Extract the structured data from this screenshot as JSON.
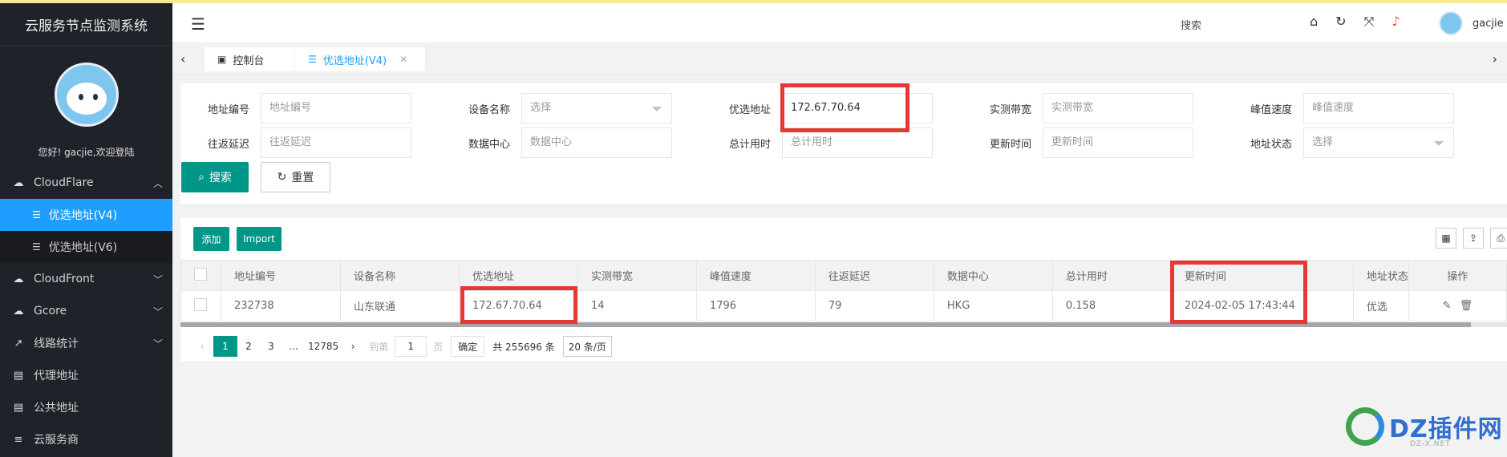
{
  "app": {
    "title": "云服务节点监测系统",
    "welcome": "您好! gacjie,欢迎登陆"
  },
  "sidebar": {
    "items": [
      {
        "label": "CloudFlare",
        "icon": "cloud-icon",
        "expanded": true
      },
      {
        "label": "优选地址(V4)",
        "icon": "list-icon",
        "active": true
      },
      {
        "label": "优选地址(V6)",
        "icon": "list-icon"
      },
      {
        "label": "CloudFront",
        "icon": "cloud-icon"
      },
      {
        "label": "Gcore",
        "icon": "cloud-icon"
      },
      {
        "label": "线路统计",
        "icon": "chart-icon"
      },
      {
        "label": "代理地址",
        "icon": "book-icon"
      },
      {
        "label": "公共地址",
        "icon": "book-icon"
      },
      {
        "label": "云服务商",
        "icon": "server-icon"
      }
    ]
  },
  "header": {
    "search_label": "搜索",
    "user_name": "gacjie"
  },
  "tabs": [
    {
      "label": "控制台"
    },
    {
      "label": "优选地址(V4)"
    }
  ],
  "filters": {
    "row1": [
      {
        "label": "地址编号",
        "placeholder": "地址编号",
        "value": ""
      },
      {
        "label": "设备名称",
        "placeholder": "选择",
        "value": ""
      },
      {
        "label": "优选地址",
        "placeholder": "",
        "value": "172.67.70.64"
      },
      {
        "label": "实测带宽",
        "placeholder": "实测带宽",
        "value": ""
      },
      {
        "label": "峰值速度",
        "placeholder": "峰值速度",
        "value": ""
      }
    ],
    "row2": [
      {
        "label": "往返延迟",
        "placeholder": "往返延迟",
        "value": ""
      },
      {
        "label": "数据中心",
        "placeholder": "数据中心",
        "value": ""
      },
      {
        "label": "总计用时",
        "placeholder": "总计用时",
        "value": ""
      },
      {
        "label": "更新时间",
        "placeholder": "更新时间",
        "value": ""
      },
      {
        "label": "地址状态",
        "placeholder": "选择",
        "value": ""
      }
    ],
    "search_button": "搜索",
    "reset_button": "重置"
  },
  "toolbar": {
    "add_label": "添加",
    "import_label": "Import"
  },
  "table": {
    "columns": [
      "地址编号",
      "设备名称",
      "优选地址",
      "实测带宽",
      "峰值速度",
      "往返延迟",
      "数据中心",
      "总计用时",
      "更新时间",
      "地址状态",
      "操作"
    ],
    "rows": [
      [
        "232738",
        "山东联通",
        "172.67.70.64",
        "14",
        "1796",
        "79",
        "HKG",
        "0.158",
        "2024-02-05 17:43:44",
        "优选"
      ]
    ]
  },
  "pager": {
    "pages": [
      "1",
      "2",
      "3",
      "…",
      "12785"
    ],
    "goto_label": "到第",
    "goto_value": "1",
    "page_suffix": "页",
    "confirm": "确定",
    "total": "共 255696 条",
    "page_size": "20 条/页"
  },
  "watermark": {
    "text": "DZ插件网",
    "sub": "DZ-X.NET"
  },
  "colors": {
    "sidebar": "#20222a",
    "active": "#1e9fff",
    "primary": "#009688",
    "highlight": "#e53935"
  }
}
